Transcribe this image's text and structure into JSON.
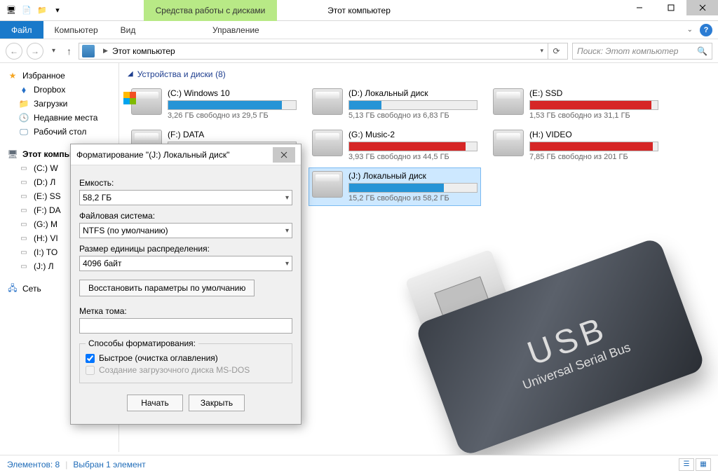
{
  "window": {
    "title": "Этот компьютер"
  },
  "ribbon_context": "Средства работы с дисками",
  "menu": {
    "file": "Файл",
    "computer": "Компьютер",
    "view": "Вид",
    "manage": "Управление"
  },
  "nav": {
    "breadcrumb": "Этот компьютер",
    "search_placeholder": "Поиск: Этот компьютер"
  },
  "sidebar": {
    "favorites": "Избранное",
    "fav_items": [
      "Dropbox",
      "Загрузки",
      "Недавние места",
      "Рабочий стол"
    ],
    "this_pc": "Этот компьютер",
    "pc_items": [
      "(C:) W",
      "(D:) Л",
      "(E:) SS",
      "(F:) DA",
      "(G:) M",
      "(H:) VI",
      "(I:) TO",
      "(J:) Л"
    ],
    "network": "Сеть"
  },
  "section": {
    "title": "Устройства и диски",
    "count": "(8)"
  },
  "drives": [
    {
      "name": "(C:) Windows 10",
      "free": "3,26 ГБ свободно из 29,5 ГБ",
      "pct": 89,
      "color": "blue",
      "win": true
    },
    {
      "name": "(D:) Локальный диск",
      "free": "5,13 ГБ свободно из 6,83 ГБ",
      "pct": 25,
      "color": "blue"
    },
    {
      "name": "(E:) SSD",
      "free": "1,53 ГБ свободно из 31,1 ГБ",
      "pct": 95,
      "color": "red"
    },
    {
      "name": "(F:) DATA",
      "free": "",
      "pct": 0,
      "color": "blue"
    },
    {
      "name": "(G:) Music-2",
      "free": "3,93 ГБ свободно из 44,5 ГБ",
      "pct": 91,
      "color": "red"
    },
    {
      "name": "(H:) VIDEO",
      "free": "7,85 ГБ свободно из 201 ГБ",
      "pct": 96,
      "color": "red"
    },
    {
      "name": "",
      "free": "",
      "pct": 0,
      "hidden": true
    },
    {
      "name": "(J:) Локальный диск",
      "free": "15,2 ГБ свободно из 58,2 ГБ",
      "pct": 74,
      "color": "blue",
      "selected": true
    }
  ],
  "dialog": {
    "title": "Форматирование \"(J:) Локальный диск\"",
    "capacity_label": "Емкость:",
    "capacity_value": "58,2 ГБ",
    "fs_label": "Файловая система:",
    "fs_value": "NTFS (по умолчанию)",
    "alloc_label": "Размер единицы распределения:",
    "alloc_value": "4096 байт",
    "restore_defaults": "Восстановить параметры по умолчанию",
    "volume_label": "Метка тома:",
    "volume_value": "",
    "methods_label": "Способы форматирования:",
    "quick_format": "Быстрое (очистка оглавления)",
    "msdos_boot": "Создание загрузочного диска MS-DOS",
    "start": "Начать",
    "close": "Закрыть"
  },
  "status": {
    "count": "Элементов: 8",
    "selection": "Выбран 1 элемент"
  },
  "usb": {
    "big": "USB",
    "small": "Universal Serial Bus"
  }
}
